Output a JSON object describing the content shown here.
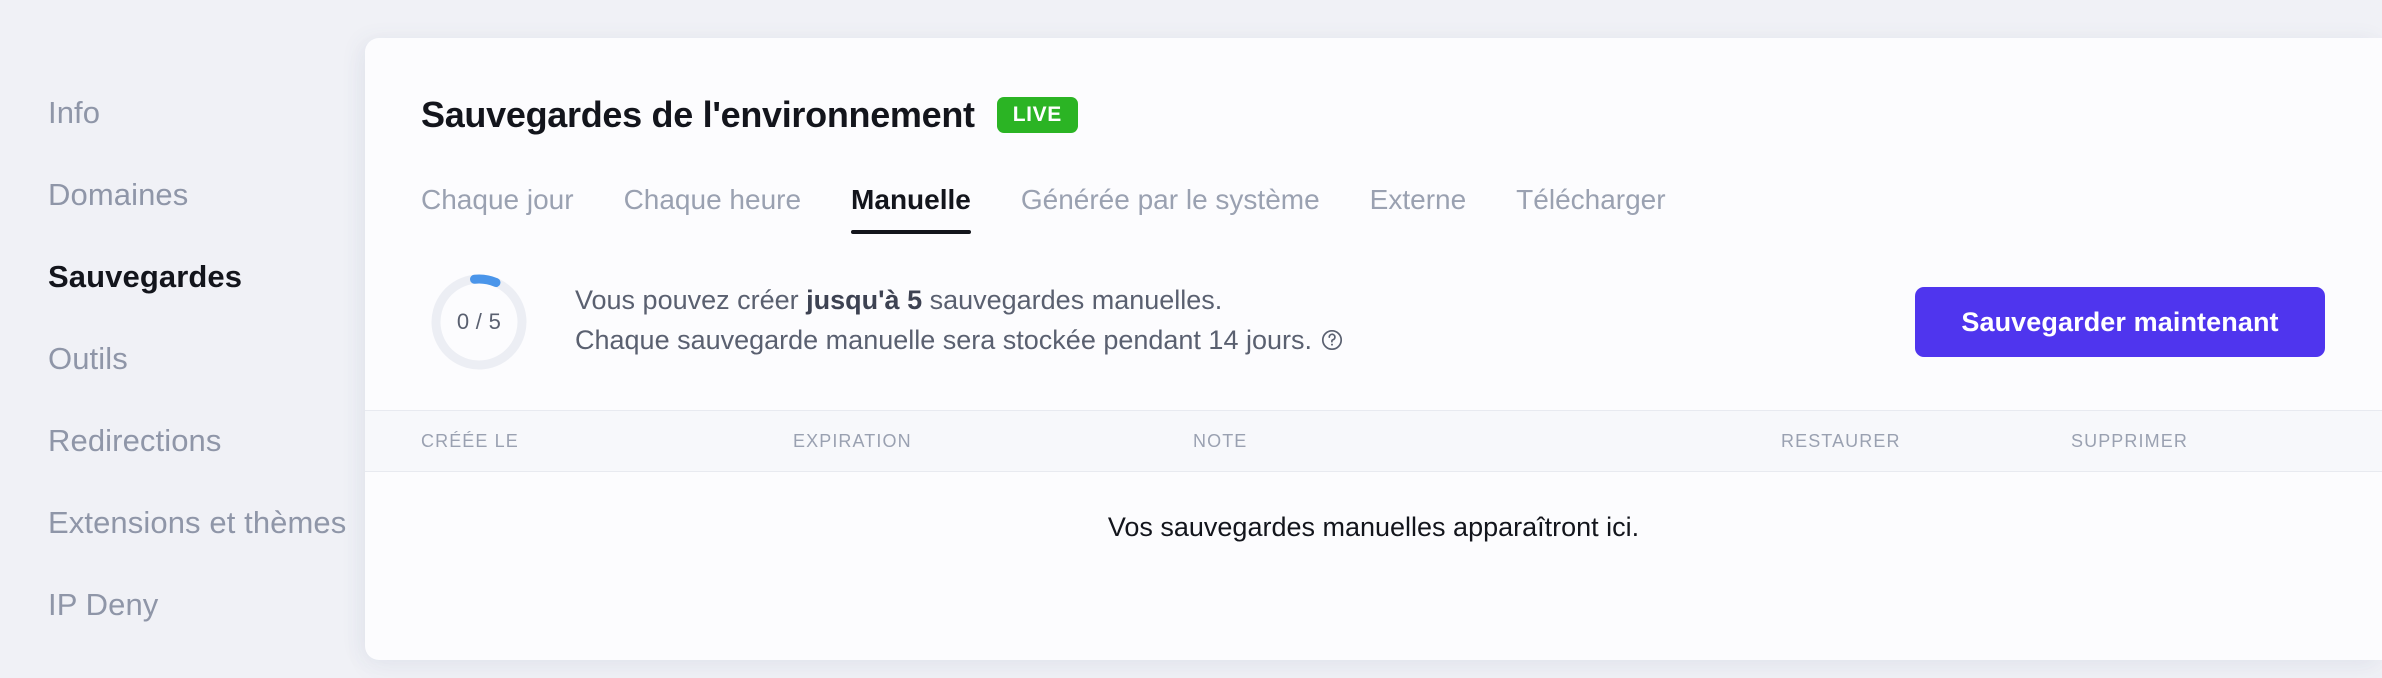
{
  "sidebar": {
    "items": [
      {
        "label": "Info",
        "active": false
      },
      {
        "label": "Domaines",
        "active": false
      },
      {
        "label": "Sauvegardes",
        "active": true
      },
      {
        "label": "Outils",
        "active": false
      },
      {
        "label": "Redirections",
        "active": false
      },
      {
        "label": "Extensions et thèmes",
        "active": false
      },
      {
        "label": "IP Deny",
        "active": false
      }
    ]
  },
  "header": {
    "title": "Sauvegardes de l'environnement",
    "badge": "LIVE",
    "badge_color": "#2bb424"
  },
  "tabs": [
    {
      "label": "Chaque jour",
      "active": false
    },
    {
      "label": "Chaque heure",
      "active": false
    },
    {
      "label": "Manuelle",
      "active": true
    },
    {
      "label": "Générée par le système",
      "active": false
    },
    {
      "label": "Externe",
      "active": false
    },
    {
      "label": "Télécharger",
      "active": false
    }
  ],
  "quota": {
    "ring_label": "0 / 5",
    "used": 0,
    "total": 5,
    "ring_track_color": "#eceef4",
    "ring_progress_color": "#4a95ea",
    "line1_prefix": "Vous pouvez créer ",
    "line1_strong": "jusqu'à 5",
    "line1_suffix": " sauvegardes manuelles.",
    "line2": "Chaque sauvegarde manuelle sera stockée pendant 14 jours.",
    "help_icon": "question-circle-icon"
  },
  "actions": {
    "backup_now": "Sauvegarder maintenant",
    "button_color": "#4f35ee"
  },
  "table": {
    "columns": [
      "CRÉÉE LE",
      "EXPIRATION",
      "NOTE",
      "RESTAURER",
      "SUPPRIMER"
    ],
    "rows": [],
    "empty_message": "Vos sauvegardes manuelles apparaîtront ici."
  }
}
